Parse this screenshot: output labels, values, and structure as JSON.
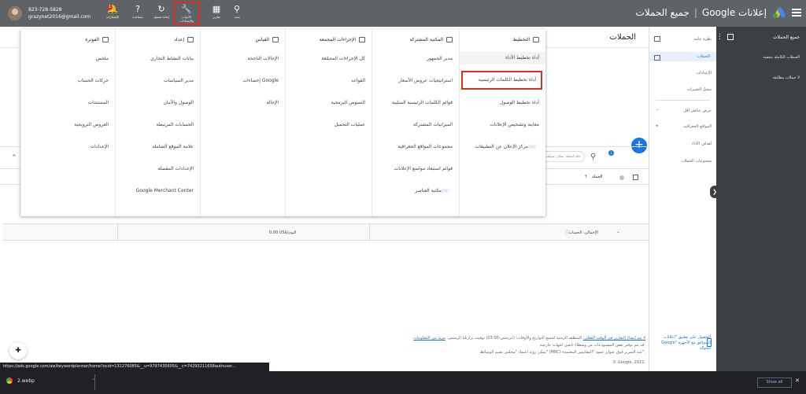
{
  "app": {
    "brand": "إعلانات Google",
    "section": "جميع الحملات"
  },
  "account": {
    "phone": "823-728-5828",
    "email": "grazynet2016@gmail.com"
  },
  "toolbar": [
    {
      "label": "بحث",
      "icon": "search-icon",
      "glyph": "⚲"
    },
    {
      "label": "تقارير",
      "icon": "reports-icon",
      "glyph": "▦"
    },
    {
      "label": "الأدوات والإعدادات",
      "icon": "wrench-icon",
      "glyph": "🔧",
      "active": true
    },
    {
      "label": "إعادة تحميل",
      "icon": "refresh-icon",
      "glyph": "↻"
    },
    {
      "label": "مساعدة",
      "icon": "help-icon",
      "glyph": "?"
    },
    {
      "label": "الإشعارات",
      "icon": "bell-icon",
      "glyph": "🔔",
      "badge": "1"
    }
  ],
  "left_panel": {
    "title": "جميع الحملات",
    "rows": [
      "الحملات الكاملة مخفية",
      "لا حملات مطابقة"
    ]
  },
  "nav": {
    "items": [
      "نظرة عامة",
      "الحملات",
      "الإعدادات",
      "سجل التغييرات",
      "عرض عناصر أقل",
      "المواقع الجغرافية",
      "أهداف الأداء",
      "مجموعات الحملات"
    ],
    "active_index": 1,
    "promo": "الحصول على تطبيق \"إعلانات Google\" المتوافق مع الأجهزة الجوالة"
  },
  "main": {
    "title": "الحملات",
    "filter_chip": "حالة الحملة: مفعّل، متوقّف",
    "filter_badge": "1",
    "fab": "+",
    "columns": {
      "campaign": "الحملة"
    },
    "total": {
      "label": "الإجمالي: الحساب",
      "amount": "0.00 US$/اليوم"
    }
  },
  "mega_menu": {
    "columns": [
      {
        "header": "التخطيط",
        "icon": "calendar-icon",
        "items": [
          {
            "label": "أداة تخطيط الأداء",
            "hl": true
          },
          {
            "label": "أداة تخطيط الكلمات الرئيسية",
            "boxed": true
          },
          {
            "label": "أداة تخطيط الوصول"
          },
          {
            "label": "معاينة وتشخيص الإعلانات"
          },
          {
            "label": "مركز الإعلان عن التطبيقات",
            "tag": "NEW"
          }
        ]
      },
      {
        "header": "المكتبة المشتركة",
        "icon": "library-icon",
        "items": [
          {
            "label": "مدير الجمهور"
          },
          {
            "label": "استراتيجيات عروض الأسعار"
          },
          {
            "label": "قوائم الكلمات الرئيسية السلبية"
          },
          {
            "label": "الميزانيات المشتركة"
          },
          {
            "label": "مجموعات المواقع الجغرافية"
          },
          {
            "label": "قوائم استبعاد مواضع الإعلانات"
          },
          {
            "label": "مكتبة العناصر",
            "tag": "NEW"
          }
        ]
      },
      {
        "header": "الإجراءات المجمعة",
        "icon": "bulk-actions-icon",
        "items": [
          {
            "label": "كل الإجراءات المجمّعة"
          },
          {
            "label": "القواعد"
          },
          {
            "label": "النصوص البرمجية"
          },
          {
            "label": "عمليات التحميل"
          }
        ]
      },
      {
        "header": "القياس",
        "icon": "hourglass-icon",
        "items": [
          {
            "label": "الإحالات الناجحة"
          },
          {
            "label": "إحصاءات Google"
          },
          {
            "label": "الإحالة"
          }
        ]
      },
      {
        "header": "إعداد",
        "icon": "setup-icon",
        "items": [
          {
            "label": "بيانات النشاط التجاري"
          },
          {
            "label": "مدير السياسات"
          },
          {
            "label": "الوصول والأمان"
          },
          {
            "label": "الحسابات المرتبطة"
          },
          {
            "label": "علامة الموقع الشاملة"
          },
          {
            "label": "الإعدادات المفضلة"
          },
          {
            "label": "Google Merchant Center"
          }
        ]
      },
      {
        "header": "الفوترة",
        "icon": "credit-card-icon",
        "items": [
          {
            "label": "ملخص"
          },
          {
            "label": "حركات الحساب"
          },
          {
            "label": "المستندات"
          },
          {
            "label": "العروض الترويجية"
          },
          {
            "label": "الإعدادات"
          }
        ]
      }
    ]
  },
  "footer": {
    "line1_link": "لا يتم إنشاء التقارير في الوقت الفعلي.",
    "line1": "المنطقة الزمنية لجميع التواريخ والأوقات: (غرينتش-03:00) توقيت برازيليا الرسمي.",
    "line1_link2": "مزيد من المعلومات",
    "line2": "قد يتم توفير بعض المستودعات من وسطاء تابعين لجهات خارجية.",
    "line3": "يمكن رؤية اعتماد \"مجلس تقييم الوسائط\" (MRC) عند التمرير فوق عنوان عمود \"المقاييس المعتمدة\".",
    "copyright": "© Google، 2022."
  },
  "status_url": "https://ads.google.com/aw/keywordplanner/home?ocid=131276085&__u=9797435605&__c=74293211658authuser...",
  "taskbar": {
    "download_name": "2.webp",
    "show_all": "Show all"
  }
}
